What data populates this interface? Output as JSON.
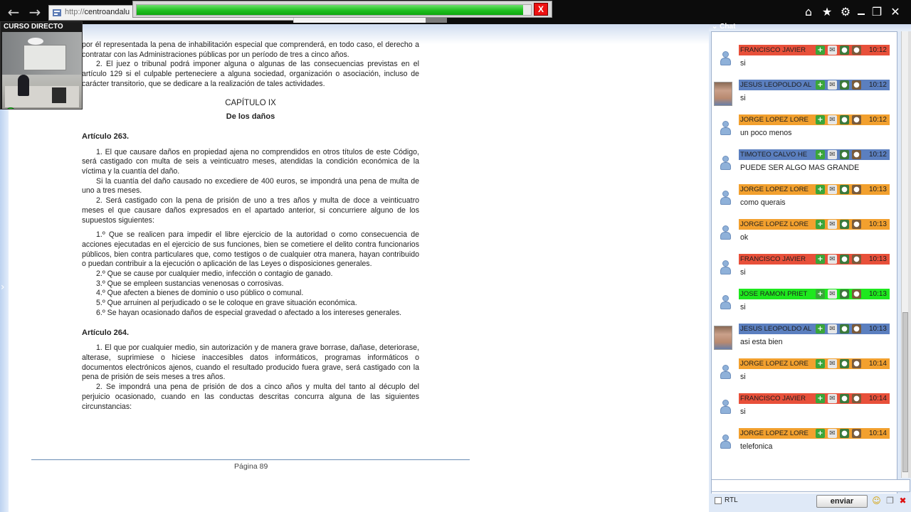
{
  "browser": {
    "back_icon": "←",
    "forward_icon": "→",
    "url_scheme": "http://",
    "url_host": "centroandalu",
    "home_icon": "⌂",
    "star_icon": "★",
    "gear_icon": "⚙",
    "restore_icon": "❐",
    "close_icon": "✕"
  },
  "progress": {
    "fraction": 0.98,
    "close_label": "X"
  },
  "webcam": {
    "title": "CURSO DIRECTO"
  },
  "document": {
    "para_1": "por él representada la pena de inhabilitación especial que comprenderá, en todo caso, el derecho a contratar con las Administraciones públicas por un período de tres a cinco años.",
    "para_2": "2. El juez o tribunal podrá imponer alguna o algunas de las consecuencias previstas en el artículo 129 si el culpable perteneciere a alguna sociedad, organización o asociación, incluso de carácter transitorio, que se dedicare a la realización de tales actividades.",
    "chapter": "CAPÍTULO IX",
    "chapter_title": "De los daños",
    "art_263": "Artículo 263.",
    "p263_1": "1. El que causare daños en propiedad ajena no comprendidos en otros títulos de este Código, será castigado con multa de seis a veinticuatro meses, atendidas la condición económica de la víctima y la cuantía del daño.",
    "p263_2": "Si la cuantía del daño causado no excediere de 400 euros, se impondrá una pena de multa de uno a tres meses.",
    "p263_3": "2. Será castigado con la pena de prisión de uno a tres años y multa de doce a veinticuatro meses el que causare daños expresados en el apartado anterior, si concurriere alguno de los supuestos siguientes:",
    "p263_4": "1.º Que se realicen para impedir el libre ejercicio de la autoridad o como consecuencia de acciones ejecutadas en el ejercicio de sus funciones, bien se cometiere el delito contra funcionarios públicos, bien contra particulares que, como testigos o de cualquier otra manera, hayan contribuido o puedan contribuir a la ejecución o aplicación de las Leyes o disposiciones generales.",
    "p263_5": "2.º Que se cause por cualquier medio, infección o contagio de ganado.",
    "p263_6": "3.º Que se empleen sustancias venenosas o corrosivas.",
    "p263_7": "4.º Que afecten a bienes de dominio o uso público o comunal.",
    "p263_8": "5.º Que arruinen al perjudicado o se le coloque en grave situación económica.",
    "p263_9": "6.º Se hayan ocasionado daños de especial gravedad o afectado a los intereses generales.",
    "art_264": "Artículo 264.",
    "p264_1": "1. El que por cualquier medio, sin autorización y de manera grave borrase, dañase, deteriorase, alterase, suprimiese o hiciese inaccesibles datos informáticos, programas informáticos o documentos electrónicos ajenos, cuando el resultado producido fuera grave, será castigado con la pena de prisión de seis meses a tres años.",
    "p264_2": "2. Se impondrá una pena de prisión de dos a cinco años y multa del tanto al décuplo del perjuicio ocasionado, cuando en las conductas descritas concurra alguna de las siguientes circunstancias:",
    "page_label": "Página 89"
  },
  "chat": {
    "title": "Chat",
    "rtl_label": "RTL",
    "send_label": "enviar",
    "emoji_icon": "☺",
    "copy_icon": "❐",
    "clear_icon": "✖",
    "messages": [
      {
        "name": "",
        "time": "",
        "text": "SI",
        "color": "#e8503a",
        "avatar": "default"
      },
      {
        "name": "FRANCISCO JAVIER",
        "time": "10:12",
        "text": "si",
        "color": "#e8503a",
        "avatar": "default"
      },
      {
        "name": "JESUS LEOPOLDO AL",
        "time": "10:12",
        "text": "si",
        "color": "#5b7fbf",
        "avatar": "photo"
      },
      {
        "name": "JORGE LOPEZ LORE",
        "time": "10:12",
        "text": "un poco menos",
        "color": "#f2a02e",
        "avatar": "default"
      },
      {
        "name": "TIMOTEO CALVO HE",
        "time": "10:12",
        "text": "PUEDE SER ALGO MAS GRANDE",
        "color": "#5b7fbf",
        "avatar": "default"
      },
      {
        "name": "JORGE LOPEZ LORE",
        "time": "10:13",
        "text": "como querais",
        "color": "#f2a02e",
        "avatar": "default"
      },
      {
        "name": "JORGE LOPEZ LORE",
        "time": "10:13",
        "text": "ok",
        "color": "#f2a02e",
        "avatar": "default"
      },
      {
        "name": "FRANCISCO JAVIER",
        "time": "10:13",
        "text": "si",
        "color": "#e8503a",
        "avatar": "default"
      },
      {
        "name": "JOSE RAMON PRIET",
        "time": "10:13",
        "text": "si",
        "color": "#1ee81e",
        "avatar": "default"
      },
      {
        "name": "JESUS LEOPOLDO AL",
        "time": "10:13",
        "text": "asi esta bien",
        "color": "#5b7fbf",
        "avatar": "photo"
      },
      {
        "name": "JORGE LOPEZ LORE",
        "time": "10:14",
        "text": "si",
        "color": "#f2a02e",
        "avatar": "default"
      },
      {
        "name": "FRANCISCO JAVIER",
        "time": "10:14",
        "text": "si",
        "color": "#e8503a",
        "avatar": "default"
      },
      {
        "name": "JORGE LOPEZ LORE",
        "time": "10:14",
        "text": "telefonica",
        "color": "#f2a02e",
        "avatar": "default"
      }
    ]
  }
}
